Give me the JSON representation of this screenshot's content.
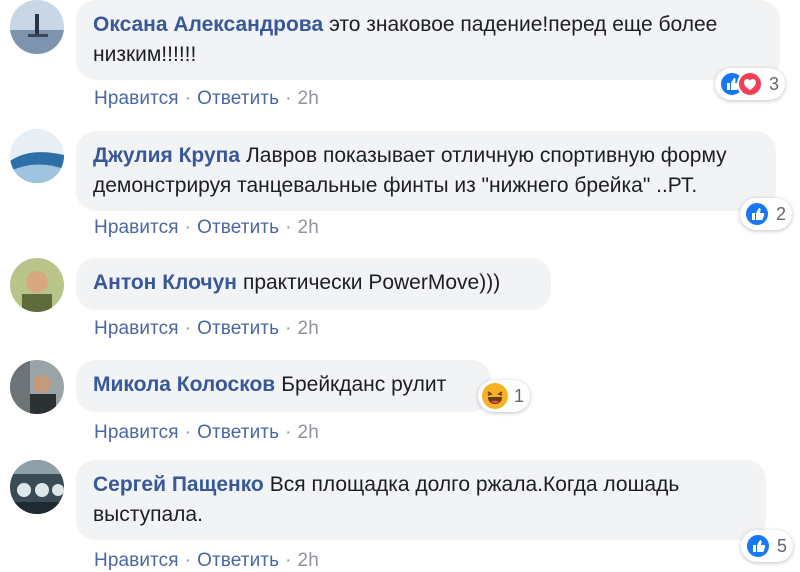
{
  "comments": [
    {
      "author": "Оксана Александрова",
      "text_line1": "это знаковое падение!перед еще более",
      "text_line2": "низким!!!!!!",
      "like": "Нравится",
      "reply": "Ответить",
      "time": "2h",
      "reaction_count": "3",
      "reactions": [
        "like-icon",
        "love-icon"
      ]
    },
    {
      "author": "Джулия Крупа",
      "text_line1": "Лавров показывает отличную спортивную форму",
      "text_line2": "демонстрируя танцевальные финты из \"нижнего брейка\" ..РТ.",
      "like": "Нравится",
      "reply": "Ответить",
      "time": "2h",
      "reaction_count": "2",
      "reactions": [
        "like-icon"
      ]
    },
    {
      "author": "Антон Клочун",
      "text_line1": "практически PowerMove)))",
      "like": "Нравится",
      "reply": "Ответить",
      "time": "2h"
    },
    {
      "author": "Микола Колосков",
      "text_line1": "Брейкданс рулит",
      "like": "Нравится",
      "reply": "Ответить",
      "time": "2h",
      "reaction_count": "1",
      "reactions": [
        "haha-icon"
      ]
    },
    {
      "author": "Сергей Пащенко",
      "text_line1": "Вся площадка долго ржала.Когда лошадь",
      "text_line2": "выступала.",
      "like": "Нравится",
      "reply": "Ответить",
      "time": "2h",
      "reaction_count": "5",
      "reactions": [
        "like-icon"
      ]
    }
  ],
  "separator": "·",
  "colors": {
    "author": "#385898",
    "link": "#4b67a1",
    "bubble": "#f2f3f5",
    "like": "#1877f2",
    "love": "#f33e58",
    "haha": "#f7b125"
  }
}
